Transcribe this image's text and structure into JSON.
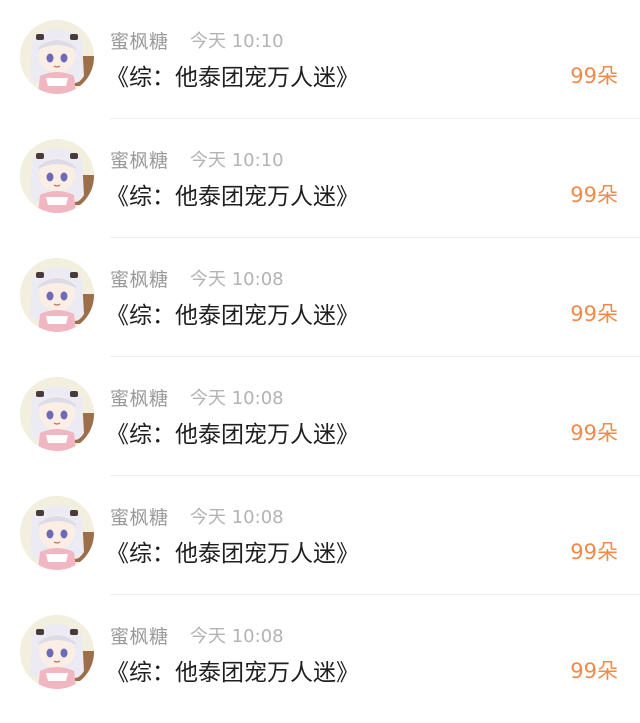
{
  "items": [
    {
      "avatar_icon": "anime-girl-avatar-icon",
      "name": "蜜枫糖",
      "time": "今天 10:10",
      "title": "《综：他泰团宠万人迷》",
      "amount": "99朵"
    },
    {
      "avatar_icon": "anime-girl-avatar-icon",
      "name": "蜜枫糖",
      "time": "今天 10:10",
      "title": "《综：他泰团宠万人迷》",
      "amount": "99朵"
    },
    {
      "avatar_icon": "anime-girl-avatar-icon",
      "name": "蜜枫糖",
      "time": "今天 10:08",
      "title": "《综：他泰团宠万人迷》",
      "amount": "99朵"
    },
    {
      "avatar_icon": "anime-girl-avatar-icon",
      "name": "蜜枫糖",
      "time": "今天 10:08",
      "title": "《综：他泰团宠万人迷》",
      "amount": "99朵"
    },
    {
      "avatar_icon": "anime-girl-avatar-icon",
      "name": "蜜枫糖",
      "time": "今天 10:08",
      "title": "《综：他泰团宠万人迷》",
      "amount": "99朵"
    },
    {
      "avatar_icon": "anime-girl-avatar-icon",
      "name": "蜜枫糖",
      "time": "今天 10:08",
      "title": "《综：他泰团宠万人迷》",
      "amount": "99朵"
    }
  ],
  "colors": {
    "amount": "#f08a4b",
    "name": "#9a9a9a",
    "time": "#b3b3b3",
    "title": "#1f1f1f",
    "divider": "#eeeeee"
  }
}
